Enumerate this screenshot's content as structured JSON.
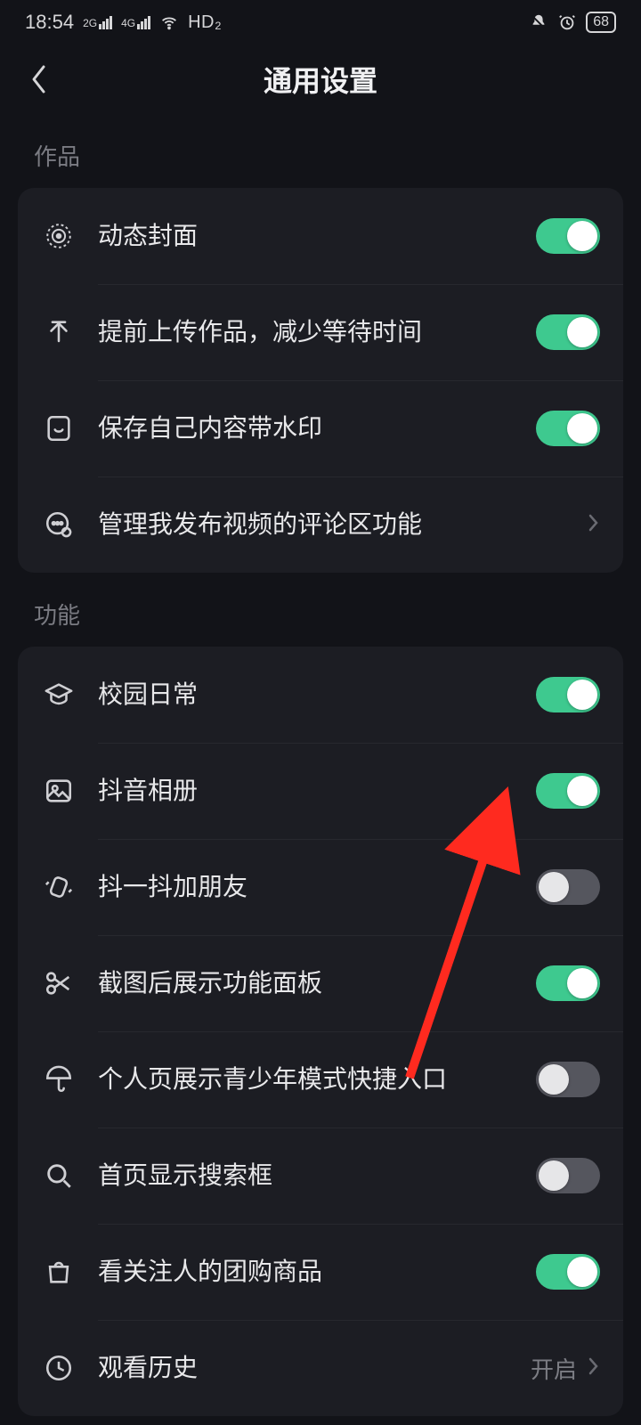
{
  "statusbar": {
    "time": "18:54",
    "hd": "HD₂",
    "battery": "68"
  },
  "header": {
    "title": "通用设置"
  },
  "sections": [
    {
      "label": "作品",
      "items": [
        {
          "icon": "target-icon",
          "label": "动态封面",
          "type": "toggle",
          "on": true
        },
        {
          "icon": "upload-icon",
          "label": "提前上传作品，减少等待时间",
          "type": "toggle",
          "on": true
        },
        {
          "icon": "save-icon",
          "label": "保存自己内容带水印",
          "type": "toggle",
          "on": true
        },
        {
          "icon": "comment-cog-icon",
          "label": "管理我发布视频的评论区功能",
          "type": "link"
        }
      ]
    },
    {
      "label": "功能",
      "items": [
        {
          "icon": "graduation-icon",
          "label": "校园日常",
          "type": "toggle",
          "on": true
        },
        {
          "icon": "gallery-icon",
          "label": "抖音相册",
          "type": "toggle",
          "on": true
        },
        {
          "icon": "shake-icon",
          "label": "抖一抖加朋友",
          "type": "toggle",
          "on": false
        },
        {
          "icon": "scissors-icon",
          "label": "截图后展示功能面板",
          "type": "toggle",
          "on": true
        },
        {
          "icon": "umbrella-icon",
          "label": "个人页展示青少年模式快捷入口",
          "type": "toggle",
          "on": false
        },
        {
          "icon": "search-icon",
          "label": "首页显示搜索框",
          "type": "toggle",
          "on": false
        },
        {
          "icon": "bag-icon",
          "label": "看关注人的团购商品",
          "type": "toggle",
          "on": true
        },
        {
          "icon": "clock-icon",
          "label": "观看历史",
          "type": "link",
          "trail": "开启"
        }
      ]
    }
  ],
  "annotation": {
    "arrow_target": "抖音相册 toggle",
    "color": "#ff2a1f"
  }
}
